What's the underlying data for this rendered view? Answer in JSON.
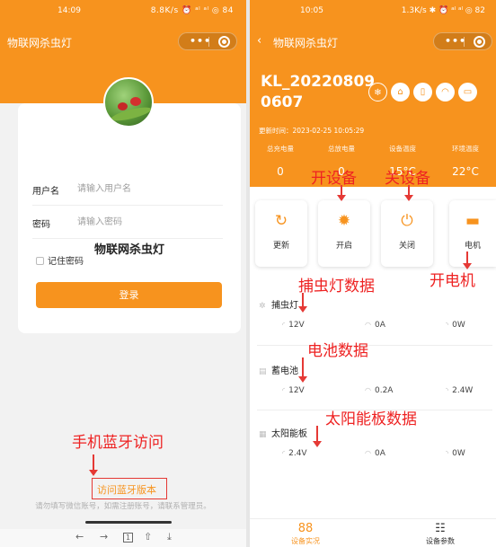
{
  "left": {
    "status": {
      "time": "14:09",
      "net": "8.8K/s ⏰ ᵃˡ ᵃˡ ◎ 84"
    },
    "nav_title": "物联网杀虫灯",
    "capsule": {
      "more": "•••"
    },
    "app_name": "物联网杀虫灯",
    "username": {
      "label": "用户名",
      "placeholder": "请输入用户名"
    },
    "password": {
      "label": "密码",
      "placeholder": "请输入密码"
    },
    "remember": "记住密码",
    "login_button": "登录",
    "annotation": "手机蓝牙访问",
    "bluetooth_link": "访问蓝牙版本",
    "hint": "请勿填写微信账号，如需注册账号，请联系管理员。",
    "browser_nav": {
      "back": "←",
      "forward": "→",
      "tabs": "1",
      "share": "⇧",
      "down": "⤓"
    }
  },
  "right": {
    "status": {
      "time": "10:05",
      "net": "1.3K/s ✱ ⏰ ᵃˡ ᵃˡ ◎ 82"
    },
    "nav": {
      "back": "‹",
      "title": "物联网杀虫灯"
    },
    "device_id": "KL_20220809 0607",
    "mode_icons": [
      {
        "name": "snowflake-icon",
        "glyph": "❄"
      },
      {
        "name": "house-icon",
        "glyph": "⌂"
      },
      {
        "name": "phone-icon",
        "glyph": "▯"
      },
      {
        "name": "wifi-icon",
        "glyph": "◠"
      },
      {
        "name": "screen-icon",
        "glyph": "▭"
      }
    ],
    "update_time": "更新时间：2023-02-25 10:05:29",
    "stats": [
      {
        "key": "总充电量",
        "value": "0"
      },
      {
        "key": "总放电量",
        "value": "0"
      },
      {
        "key": "设备温度",
        "value": "15°C"
      },
      {
        "key": "环境温度",
        "value": "22°C"
      }
    ],
    "controls": [
      {
        "name": "refresh",
        "icon": "↻",
        "label": "更新"
      },
      {
        "name": "open",
        "icon": "✹",
        "label": "开启"
      },
      {
        "name": "close",
        "icon": "⏻",
        "label": "关闭"
      },
      {
        "name": "motor",
        "icon": "▬",
        "label": "电机"
      }
    ],
    "sections": [
      {
        "title": "捕虫灯",
        "icon": "✲",
        "v": "12V",
        "a": "0A",
        "w": "0W"
      },
      {
        "title": "蓄电池",
        "icon": "▤",
        "v": "12V",
        "a": "0.2A",
        "w": "2.4W"
      },
      {
        "title": "太阳能板",
        "icon": "▦",
        "v": "2.4V",
        "a": "0A",
        "w": "0W"
      }
    ],
    "annotations": {
      "open_device": "开设备",
      "close_device": "关设备",
      "lamp_data": "捕虫灯数据",
      "motor_on": "开电机",
      "battery_data": "电池数据",
      "solar_data": "太阳能板数据"
    },
    "tabs": [
      {
        "icon": "88",
        "label": "设备实况"
      },
      {
        "icon": "☷",
        "label": "设备参数"
      }
    ]
  },
  "colors": {
    "accent": "#f7931e",
    "annotation": "#ee2222",
    "background": "#f2f2f2"
  }
}
